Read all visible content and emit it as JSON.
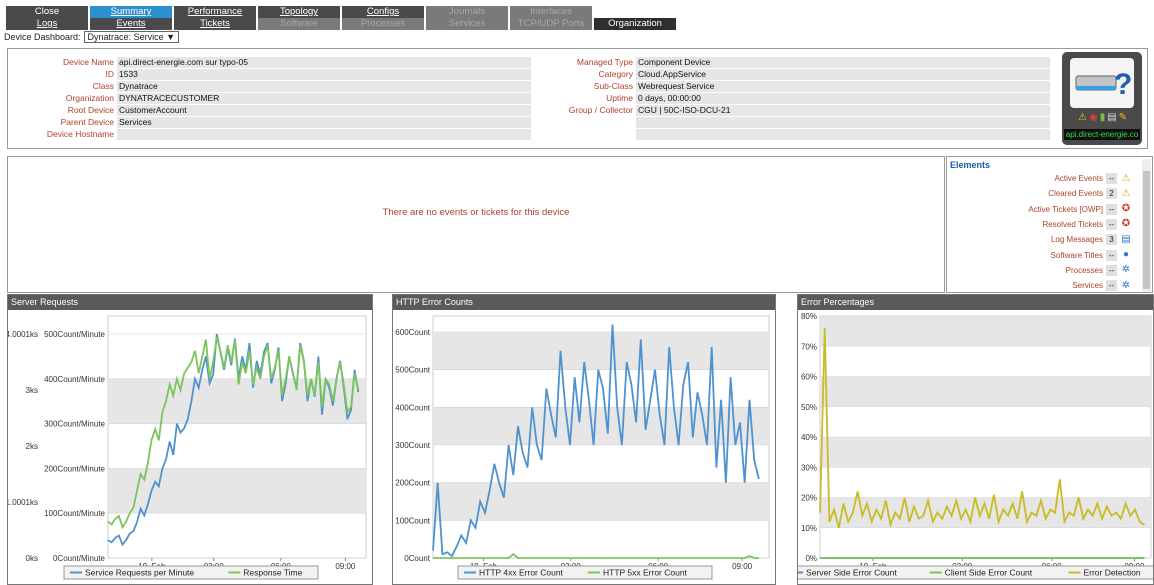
{
  "tabs": {
    "row1": [
      {
        "label": "Close",
        "state": "normal",
        "underline": false
      },
      {
        "label": "Summary",
        "state": "active",
        "underline": true
      },
      {
        "label": "Performance",
        "state": "normal",
        "underline": true
      },
      {
        "label": "Topology",
        "state": "normal",
        "underline": true
      },
      {
        "label": "Configs",
        "state": "normal",
        "underline": true
      },
      {
        "label": "Journals",
        "state": "disabled",
        "underline": false
      },
      {
        "label": "Interfaces",
        "state": "disabled",
        "underline": false
      }
    ],
    "row2": [
      {
        "label": "Logs",
        "state": "normal",
        "underline": true
      },
      {
        "label": "Events",
        "state": "normal",
        "underline": true
      },
      {
        "label": "Tickets",
        "state": "normal",
        "underline": true
      },
      {
        "label": "Software",
        "state": "disabled",
        "underline": false
      },
      {
        "label": "Processes",
        "state": "disabled",
        "underline": false
      },
      {
        "label": "Services",
        "state": "disabled",
        "underline": false
      },
      {
        "label": "TCP/UDP Ports",
        "state": "disabled",
        "underline": false
      },
      {
        "label": "Organization",
        "state": "org",
        "underline": false
      }
    ]
  },
  "dashboard": {
    "label": "Device Dashboard:",
    "selected": "Dynatrace: Service ▼"
  },
  "device": {
    "left": [
      {
        "key": "Device Name",
        "value": "api.direct-energie.com sur typo-05"
      },
      {
        "key": "ID",
        "value": "1533"
      },
      {
        "key": "Class",
        "value": "Dynatrace"
      },
      {
        "key": "Organization",
        "value": "DYNATRACECUSTOMER"
      },
      {
        "key": "Root Device",
        "value": "CustomerAccount"
      },
      {
        "key": "Parent Device",
        "value": "Services"
      },
      {
        "key": "Device Hostname",
        "value": ""
      }
    ],
    "right": [
      {
        "key": "Managed Type",
        "value": "Component Device"
      },
      {
        "key": "Category",
        "value": "Cloud.AppService"
      },
      {
        "key": "Sub-Class",
        "value": "Webrequest Service"
      },
      {
        "key": "Uptime",
        "value": "0 days, 00:00:00"
      },
      {
        "key": "Group / Collector",
        "value": "CGU | 50C-ISO-DCU-21"
      },
      {
        "key": "",
        "value": ""
      },
      {
        "key": "",
        "value": ""
      }
    ],
    "icon_hostname": "api.direct-energie.co"
  },
  "events": {
    "message": "There are no events or tickets for this device"
  },
  "elements": {
    "title": "Elements",
    "rows": [
      {
        "label": "Active Events",
        "count": "--",
        "icon": "warning-icon"
      },
      {
        "label": "Cleared Events",
        "count": "2",
        "icon": "warning-icon"
      },
      {
        "label": "Active Tickets [OWP]",
        "count": "--",
        "icon": "lifebuoy-icon"
      },
      {
        "label": "Resolved Tickets",
        "count": "--",
        "icon": "lifebuoy-icon"
      },
      {
        "label": "Log Messages",
        "count": "3",
        "icon": "log-icon"
      },
      {
        "label": "Software Titles",
        "count": "--",
        "icon": "disc-icon"
      },
      {
        "label": "Processes",
        "count": "--",
        "icon": "gear-icon"
      },
      {
        "label": "Services",
        "count": "--",
        "icon": "gear-icon"
      }
    ]
  },
  "chart_data": [
    {
      "type": "line",
      "title": "Server Requests",
      "x_ticks": [
        "19. Feb",
        "03:00",
        "06:00",
        "09:00"
      ],
      "x_range": [
        0,
        100
      ],
      "y_left_ticks": [
        "0ks",
        "1.0001ks",
        "2ks",
        "3ks",
        "4.0001ks"
      ],
      "y_left_range": [
        0,
        4000
      ],
      "y_right_ticks": [
        "0Count/Minute",
        "100Count/Minute",
        "200Count/Minute",
        "300Count/Minute",
        "400Count/Minute",
        "500Count/Minute"
      ],
      "y_right_range": [
        0,
        500
      ],
      "series": [
        {
          "name": "Service Requests per Minute",
          "color": "#4f92cf",
          "axis": "right",
          "values": [
            40,
            35,
            45,
            50,
            30,
            40,
            55,
            60,
            80,
            110,
            95,
            120,
            150,
            170,
            160,
            200,
            220,
            260,
            230,
            300,
            280,
            290,
            310,
            350,
            400,
            380,
            420,
            450,
            390,
            410,
            500,
            460,
            420,
            470,
            430,
            490,
            400,
            450,
            420,
            480,
            380,
            440,
            410,
            460,
            480,
            390,
            420,
            470,
            350,
            390,
            450,
            410,
            380,
            480,
            440,
            350,
            400,
            360,
            450,
            320,
            400,
            380,
            340,
            400,
            440,
            380,
            310,
            330,
            420,
            370
          ]
        },
        {
          "name": "Response Time",
          "color": "#7cc45c",
          "axis": "left",
          "values": [
            650,
            600,
            700,
            750,
            550,
            650,
            800,
            900,
            1200,
            1500,
            1400,
            1700,
            2100,
            2300,
            2100,
            2600,
            2800,
            3100,
            2900,
            3200,
            3000,
            3300,
            3400,
            3500,
            3700,
            3300,
            3600,
            3900,
            3200,
            3500,
            3950,
            3700,
            3400,
            3800,
            3500,
            3900,
            3100,
            3500,
            3300,
            3700,
            3100,
            3400,
            3200,
            3600,
            3800,
            3200,
            3400,
            3700,
            2900,
            3200,
            3600,
            3300,
            3000,
            3800,
            3500,
            2900,
            3200,
            2900,
            3500,
            2700,
            3200,
            3100,
            2800,
            3200,
            3500,
            3100,
            2600,
            2700,
            3300,
            3000
          ]
        }
      ]
    },
    {
      "type": "line",
      "title": "HTTP Error Counts",
      "x_ticks": [
        "19. Feb",
        "03:00",
        "06:00",
        "09:00"
      ],
      "x_range": [
        0,
        100
      ],
      "y_ticks": [
        "0Count",
        "100Count",
        "200Count",
        "300Count",
        "400Count",
        "500Count",
        "600Count"
      ],
      "y_range": [
        0,
        600
      ],
      "series": [
        {
          "name": "HTTP 4xx Error Count",
          "color": "#4f92cf",
          "values": [
            20,
            200,
            10,
            15,
            5,
            30,
            60,
            40,
            100,
            80,
            150,
            120,
            180,
            250,
            200,
            160,
            300,
            220,
            350,
            280,
            240,
            400,
            300,
            260,
            450,
            380,
            320,
            550,
            400,
            300,
            480,
            360,
            520,
            420,
            300,
            500,
            450,
            330,
            620,
            400,
            300,
            520,
            460,
            360,
            580,
            340,
            420,
            500,
            380,
            300,
            560,
            400,
            300,
            460,
            520,
            320,
            440,
            380,
            300,
            560,
            240,
            420,
            200,
            480,
            300,
            360,
            200,
            420,
            260,
            210
          ]
        },
        {
          "name": "HTTP 5xx Error Count",
          "color": "#7cc45c",
          "values": [
            0,
            0,
            0,
            0,
            0,
            0,
            0,
            0,
            0,
            0,
            0,
            0,
            0,
            0,
            0,
            0,
            0,
            10,
            0,
            0,
            0,
            0,
            0,
            0,
            0,
            0,
            0,
            0,
            0,
            0,
            0,
            0,
            0,
            0,
            0,
            0,
            0,
            0,
            0,
            0,
            0,
            0,
            0,
            0,
            0,
            0,
            0,
            0,
            0,
            0,
            0,
            0,
            0,
            0,
            0,
            0,
            0,
            0,
            0,
            0,
            0,
            0,
            0,
            0,
            0,
            0,
            0,
            5,
            0,
            0
          ]
        }
      ]
    },
    {
      "type": "line",
      "title": "Error Percentages",
      "x_ticks": [
        "19. Feb",
        "03:00",
        "06:00",
        "09:00"
      ],
      "x_range": [
        0,
        100
      ],
      "y_ticks": [
        "0%",
        "10%",
        "20%",
        "30%",
        "40%",
        "50%",
        "60%",
        "70%",
        "80%"
      ],
      "y_range": [
        0,
        80
      ],
      "series": [
        {
          "name": "Server Side Error Count",
          "color": "#4f92cf",
          "values": [
            0,
            0,
            0,
            0,
            0,
            0,
            0,
            0,
            0,
            0,
            0,
            0,
            0,
            0,
            0,
            0,
            0,
            0,
            0,
            0,
            0,
            0,
            0,
            0,
            0,
            0,
            0,
            0,
            0,
            0,
            0,
            0,
            0,
            0,
            0,
            0,
            0,
            0,
            0,
            0,
            0,
            0,
            0,
            0,
            0,
            0,
            0,
            0,
            0,
            0,
            0,
            0,
            0,
            0,
            0,
            0,
            0,
            0,
            0,
            0,
            0,
            0,
            0,
            0,
            0,
            0,
            0,
            0,
            0,
            0
          ]
        },
        {
          "name": "Client Side Error Count",
          "color": "#7cc45c",
          "values": [
            0,
            0,
            0,
            0,
            0,
            0,
            0,
            0,
            0,
            0,
            0,
            0,
            0,
            0,
            0,
            0,
            0,
            0,
            0,
            0,
            0,
            0,
            0,
            0,
            0,
            0,
            0,
            0,
            0,
            0,
            0,
            0,
            0,
            0,
            0,
            0,
            0,
            0,
            0,
            0,
            0,
            0,
            0,
            0,
            0,
            0,
            0,
            0,
            0,
            0,
            0,
            0,
            0,
            0,
            0,
            0,
            0,
            0,
            0,
            0,
            0,
            0,
            0,
            0,
            0,
            0,
            0,
            0,
            0,
            0
          ]
        },
        {
          "name": "Error Detection",
          "color": "#c9bb24",
          "values": [
            15,
            76,
            12,
            16,
            10,
            18,
            12,
            15,
            22,
            14,
            18,
            12,
            16,
            13,
            19,
            11,
            15,
            13,
            20,
            12,
            17,
            13,
            14,
            19,
            12,
            15,
            13,
            17,
            14,
            19,
            13,
            16,
            12,
            20,
            14,
            18,
            13,
            21,
            12,
            16,
            14,
            18,
            13,
            22,
            12,
            15,
            14,
            19,
            13,
            16,
            15,
            26,
            12,
            15,
            14,
            20,
            13,
            16,
            14,
            18,
            13,
            17,
            14,
            15,
            13,
            18,
            14,
            16,
            12,
            11
          ]
        }
      ]
    }
  ]
}
